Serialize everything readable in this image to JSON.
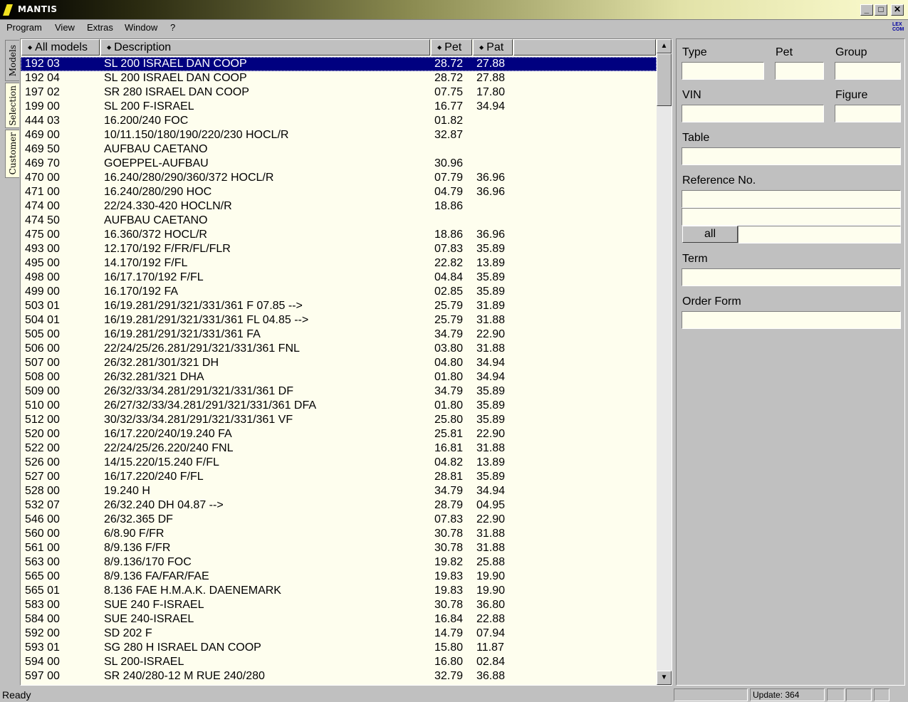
{
  "window": {
    "title": "MANTIS",
    "min_glyph": "_",
    "max_glyph": "□",
    "close_glyph": "✕"
  },
  "menu": {
    "items": [
      "Program",
      "View",
      "Extras",
      "Window",
      "?"
    ],
    "logo": "LEX COM"
  },
  "side_tabs": [
    "Models",
    "Selection",
    "Customer"
  ],
  "list": {
    "columns": [
      "All models",
      "Description",
      "Pet",
      "Pat"
    ],
    "rows": [
      {
        "model": "192 03",
        "desc": "SL 200 ISRAEL DAN COOP",
        "pet": "28.72",
        "pat": "27.88",
        "selected": true
      },
      {
        "model": "192 04",
        "desc": "SL 200 ISRAEL DAN COOP",
        "pet": "28.72",
        "pat": "27.88"
      },
      {
        "model": "197 02",
        "desc": "SR 280 ISRAEL DAN COOP",
        "pet": "07.75",
        "pat": "17.80"
      },
      {
        "model": "199 00",
        "desc": "SL 200 F-ISRAEL",
        "pet": "16.77",
        "pat": "34.94"
      },
      {
        "model": "444 03",
        "desc": "16.200/240 FOC",
        "pet": "01.82",
        "pat": ""
      },
      {
        "model": "469 00",
        "desc": "10/11.150/180/190/220/230 HOCL/R",
        "pet": "32.87",
        "pat": ""
      },
      {
        "model": "469 50",
        "desc": "AUFBAU CAETANO",
        "pet": "",
        "pat": ""
      },
      {
        "model": "469 70",
        "desc": "GOEPPEL-AUFBAU",
        "pet": "30.96",
        "pat": ""
      },
      {
        "model": "470 00",
        "desc": "16.240/280/290/360/372 HOCL/R",
        "pet": "07.79",
        "pat": "36.96"
      },
      {
        "model": "471 00",
        "desc": "16.240/280/290 HOC",
        "pet": "04.79",
        "pat": "36.96"
      },
      {
        "model": "474 00",
        "desc": "22/24.330-420 HOCLN/R",
        "pet": "18.86",
        "pat": ""
      },
      {
        "model": "474 50",
        "desc": "AUFBAU CAETANO",
        "pet": "",
        "pat": ""
      },
      {
        "model": "475 00",
        "desc": "16.360/372 HOCL/R",
        "pet": "18.86",
        "pat": "36.96"
      },
      {
        "model": "493 00",
        "desc": "12.170/192 F/FR/FL/FLR",
        "pet": "07.83",
        "pat": "35.89"
      },
      {
        "model": "495 00",
        "desc": "14.170/192 F/FL",
        "pet": "22.82",
        "pat": "13.89"
      },
      {
        "model": "498 00",
        "desc": "16/17.170/192 F/FL",
        "pet": "04.84",
        "pat": "35.89"
      },
      {
        "model": "499 00",
        "desc": "16.170/192 FA",
        "pet": "02.85",
        "pat": "35.89"
      },
      {
        "model": "503 01",
        "desc": "16/19.281/291/321/331/361 F 07.85 -->",
        "pet": "25.79",
        "pat": "31.89"
      },
      {
        "model": "504 01",
        "desc": "16/19.281/291/321/331/361 FL  04.85 -->",
        "pet": "25.79",
        "pat": "31.88"
      },
      {
        "model": "505 00",
        "desc": "16/19.281/291/321/331/361 FA",
        "pet": "34.79",
        "pat": "22.90"
      },
      {
        "model": "506 00",
        "desc": "22/24/25/26.281/291/321/331/361 FNL",
        "pet": "03.80",
        "pat": "31.88"
      },
      {
        "model": "507 00",
        "desc": "26/32.281/301/321 DH",
        "pet": "04.80",
        "pat": "34.94"
      },
      {
        "model": "508 00",
        "desc": "26/32.281/321 DHA",
        "pet": "01.80",
        "pat": "34.94"
      },
      {
        "model": "509 00",
        "desc": "26/32/33/34.281/291/321/331/361 DF",
        "pet": "34.79",
        "pat": "35.89"
      },
      {
        "model": "510 00",
        "desc": "26/27/32/33/34.281/291/321/331/361 DFA",
        "pet": "01.80",
        "pat": "35.89"
      },
      {
        "model": "512 00",
        "desc": "30/32/33/34.281/291/321/331/361 VF",
        "pet": "25.80",
        "pat": "35.89"
      },
      {
        "model": "520 00",
        "desc": "16/17.220/240/19.240 FA",
        "pet": "25.81",
        "pat": "22.90"
      },
      {
        "model": "522 00",
        "desc": "22/24/25/26.220/240 FNL",
        "pet": "16.81",
        "pat": "31.88"
      },
      {
        "model": "526 00",
        "desc": "14/15.220/15.240 F/FL",
        "pet": "04.82",
        "pat": "13.89"
      },
      {
        "model": "527 00",
        "desc": "16/17.220/240 F/FL",
        "pet": "28.81",
        "pat": "35.89"
      },
      {
        "model": "528 00",
        "desc": "19.240 H",
        "pet": "34.79",
        "pat": "34.94"
      },
      {
        "model": "532 07",
        "desc": "26/32.240 DH  04.87 -->",
        "pet": "28.79",
        "pat": "04.95"
      },
      {
        "model": "546 00",
        "desc": "26/32.365 DF",
        "pet": "07.83",
        "pat": "22.90"
      },
      {
        "model": "560 00",
        "desc": "6/8.90 F/FR",
        "pet": "30.78",
        "pat": "31.88"
      },
      {
        "model": "561 00",
        "desc": "8/9.136 F/FR",
        "pet": "30.78",
        "pat": "31.88"
      },
      {
        "model": "563 00",
        "desc": "8/9.136/170 FOC",
        "pet": "19.82",
        "pat": "25.88"
      },
      {
        "model": "565 00",
        "desc": "8/9.136 FA/FAR/FAE",
        "pet": "19.83",
        "pat": "19.90"
      },
      {
        "model": "565 01",
        "desc": "8.136 FAE H.M.A.K. DAENEMARK",
        "pet": "19.83",
        "pat": "19.90"
      },
      {
        "model": "583 00",
        "desc": "SUE 240 F-ISRAEL",
        "pet": "30.78",
        "pat": "36.80"
      },
      {
        "model": "584 00",
        "desc": "SUE 240-ISRAEL",
        "pet": "16.84",
        "pat": "22.88"
      },
      {
        "model": "592 00",
        "desc": "SD 202 F",
        "pet": "14.79",
        "pat": "07.94"
      },
      {
        "model": "593 01",
        "desc": "SG 280 H ISRAEL DAN COOP",
        "pet": "15.80",
        "pat": "11.87"
      },
      {
        "model": "594 00",
        "desc": "SL 200-ISRAEL",
        "pet": "16.80",
        "pat": "02.84"
      },
      {
        "model": "597 00",
        "desc": "SR 240/280-12 M RUE 240/280",
        "pet": "32.79",
        "pat": "36.88"
      }
    ]
  },
  "form": {
    "type_label": "Type",
    "pet_label": "Pet",
    "group_label": "Group",
    "vin_label": "VIN",
    "figure_label": "Figure",
    "table_label": "Table",
    "reference_label": "Reference No.",
    "all_label": "all",
    "term_label": "Term",
    "order_label": "Order Form"
  },
  "status": {
    "ready": "Ready",
    "update": "Update: 364"
  }
}
